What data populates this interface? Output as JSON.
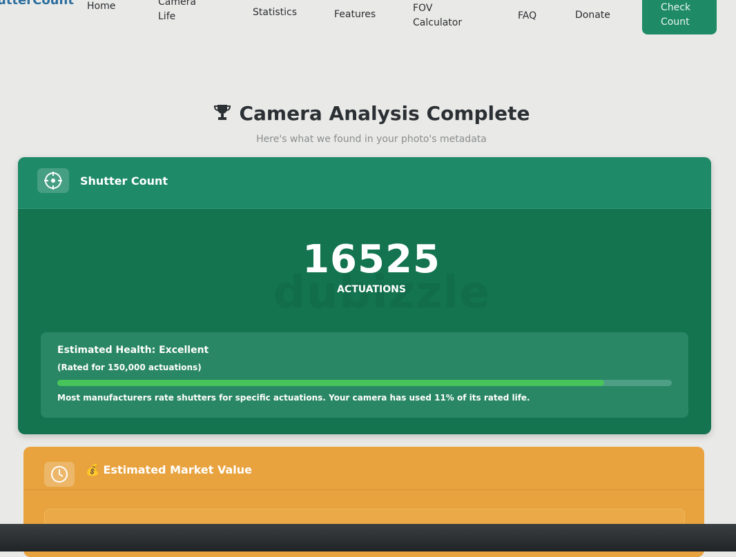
{
  "nav": {
    "brand": "utterCount",
    "items": [
      {
        "id": "home",
        "label": "Home"
      },
      {
        "id": "camera-life-1",
        "label": "Camera"
      },
      {
        "id": "camera-life-2",
        "label": "Life"
      },
      {
        "id": "statistics",
        "label": "Statistics"
      },
      {
        "id": "features",
        "label": "Features"
      },
      {
        "id": "fov-1",
        "label": "FOV"
      },
      {
        "id": "fov-2",
        "label": "Calculator"
      },
      {
        "id": "faq",
        "label": "FAQ"
      },
      {
        "id": "donate",
        "label": "Donate"
      }
    ],
    "cta_line1": "Check",
    "cta_line2": "Count"
  },
  "hero": {
    "title": "Camera Analysis Complete",
    "subtitle": "Here's what we found in your photo's metadata",
    "icon": "trophy-icon"
  },
  "shutter_card": {
    "title": "Shutter Count",
    "icon": "target-icon",
    "count": "16525",
    "unit": "ACTUATIONS",
    "watermark": "dubizzle",
    "health_title": "Estimated Health: Excellent",
    "rated": "(Rated for 150,000 actuations)",
    "usage_fraction": 0.11,
    "note": "Most manufacturers rate shutters for specific actuations. Your camera has used 11% of its rated life."
  },
  "market_card": {
    "title": "💰 Estimated Market Value",
    "icon": "clock-icon"
  },
  "colors": {
    "green": "#13744f",
    "orange": "#e8a33f",
    "progress": "#47c45a"
  }
}
